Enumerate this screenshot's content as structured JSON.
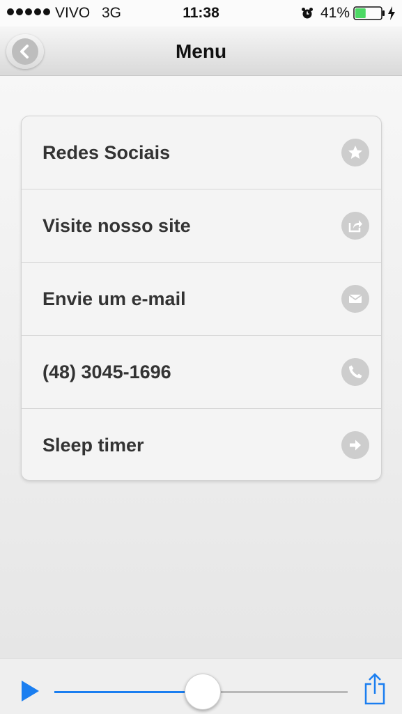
{
  "status_bar": {
    "carrier": "VIVO",
    "network": "3G",
    "time": "11:38",
    "battery_percent": "41%",
    "battery_level": 0.41,
    "battery_color": "#4cd964"
  },
  "nav": {
    "title": "Menu",
    "back_icon": "chevron-left-icon"
  },
  "menu": {
    "items": [
      {
        "label": "Redes Sociais",
        "icon": "star-icon"
      },
      {
        "label": "Visite nosso site",
        "icon": "share-arrow-icon"
      },
      {
        "label": "Envie um e-mail",
        "icon": "envelope-icon"
      },
      {
        "label": "(48) 3045-1696",
        "icon": "phone-icon"
      },
      {
        "label": "Sleep timer",
        "icon": "arrow-right-icon"
      }
    ]
  },
  "player": {
    "play_icon": "play-icon",
    "progress": 0.503,
    "accent_color": "#1a7ef0",
    "share_icon": "share-icon"
  }
}
